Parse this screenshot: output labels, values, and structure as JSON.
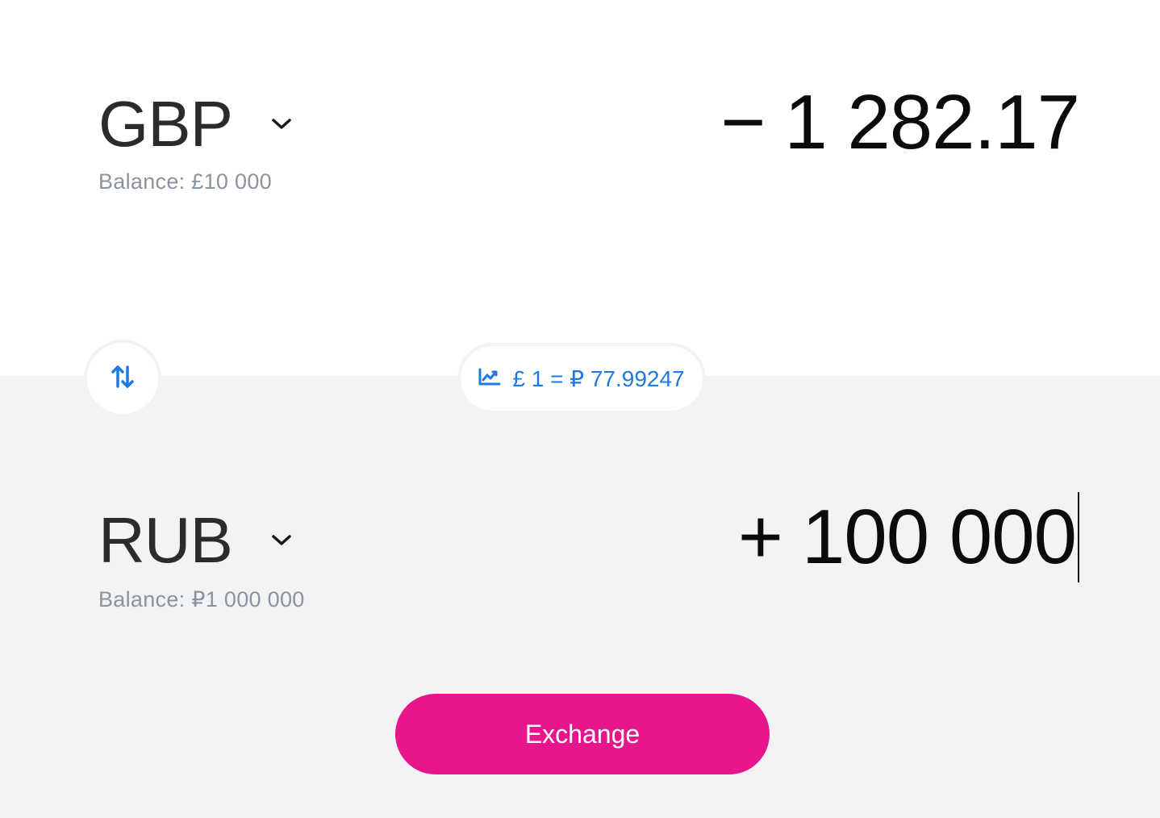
{
  "from": {
    "currency_code": "GBP",
    "balance_label": "Balance:",
    "balance_value": "£10 000",
    "amount_sign": "−",
    "amount_value": "1 282.17",
    "chevron_icon": "chevron-down-icon"
  },
  "to": {
    "currency_code": "RUB",
    "balance_label": "Balance:",
    "balance_value": "₽1 000 000",
    "amount_sign": "+",
    "amount_value": "100 000",
    "chevron_icon": "chevron-down-icon"
  },
  "swap": {
    "icon": "swap-arrows-icon"
  },
  "rate": {
    "icon": "trend-chart-icon",
    "text": "£ 1 = ₽ 77.99247"
  },
  "actions": {
    "exchange_label": "Exchange"
  },
  "colors": {
    "accent_blue": "#1f7ae0",
    "exchange_pink": "#e8168d",
    "bottom_background": "#f2f3f5",
    "muted_text": "#8b949e"
  }
}
